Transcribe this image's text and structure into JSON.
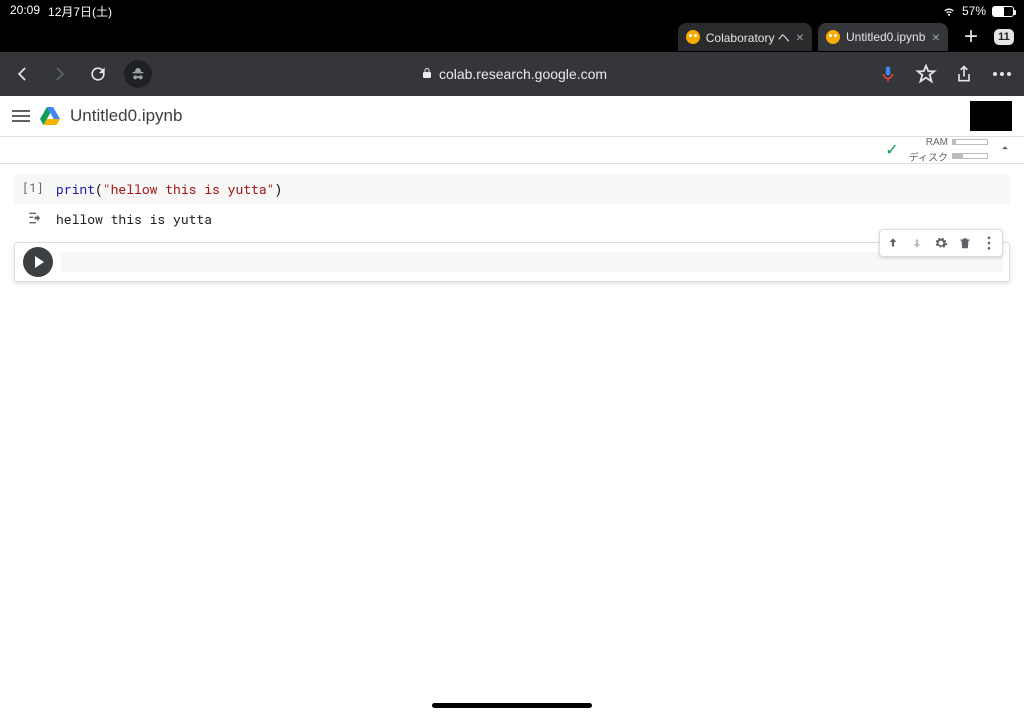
{
  "statusbar": {
    "time": "20:09",
    "date": "12月7日(土)",
    "battery_pct": "57%",
    "battery_fill": 57
  },
  "browser": {
    "tabs": [
      {
        "title": "Colaboratory ヘ",
        "active": false
      },
      {
        "title": "Untitled0.ipynb",
        "active": true
      }
    ],
    "tab_count": "11",
    "url_host": "colab.research.google.com"
  },
  "colab": {
    "notebook_name": "Untitled0.ipynb",
    "resources": {
      "ram_label": "RAM",
      "disk_label": "ディスク",
      "ram_pct": 8,
      "disk_pct": 30
    },
    "cells": [
      {
        "exec_count": "[1]",
        "code_fn": "print",
        "code_open": "(",
        "code_str": "\"hellow this is yutta\"",
        "code_close": ")",
        "output": "hellow this is yutta"
      }
    ],
    "active_cell_value": ""
  }
}
